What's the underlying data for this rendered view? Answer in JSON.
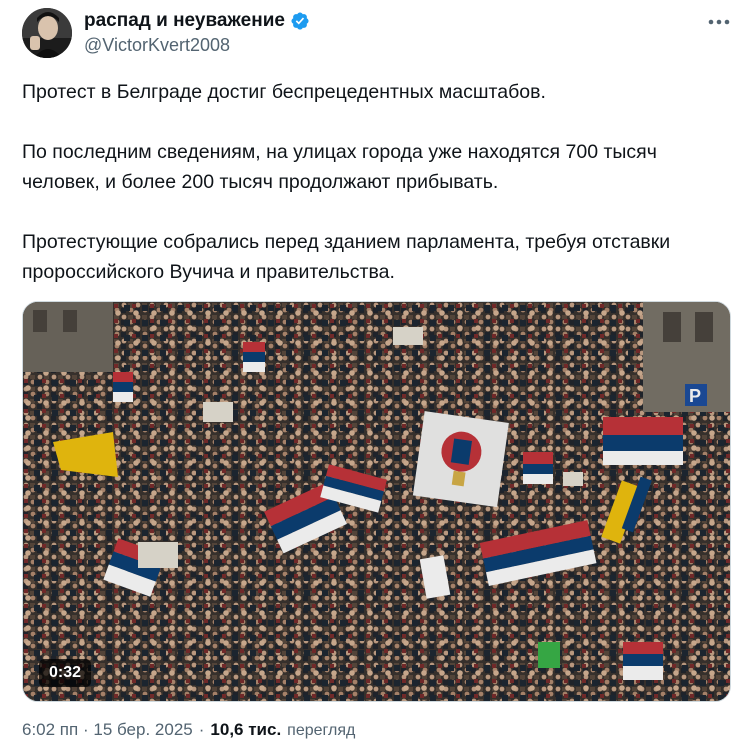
{
  "author": {
    "name": "распад и неуважение",
    "handle": "@VictorKvert2008",
    "verified": true
  },
  "tweet": {
    "paragraphs": [
      "Протест в Белграде достиг беспрецедентных масштабов.",
      "По последним сведениям, на улицах города уже находятся 700 тысяч человек, и более 200 тысяч продолжают прибывать.",
      "Протестующие собрались перед зданием парламента, требуя отставки пророссийского Вучича и правительства."
    ]
  },
  "media": {
    "type": "video",
    "duration": "0:32",
    "scene_flag_colors": {
      "serbian_red": "#c6363c",
      "serbian_blue": "#0c4076",
      "white": "#ffffff",
      "yellow": "#f2c40f"
    }
  },
  "meta": {
    "time": "6:02 пп",
    "separator": "·",
    "date": "15 бер. 2025",
    "views_separator": "·",
    "views_count": "10,6 тис.",
    "views_label": "перегляд"
  },
  "colors": {
    "text_primary": "#0f1419",
    "text_secondary": "#536471",
    "verified_blue": "#1d9bf0"
  },
  "icons": {
    "more": "more-horizontal-icon",
    "verified": "verified-badge-icon"
  }
}
